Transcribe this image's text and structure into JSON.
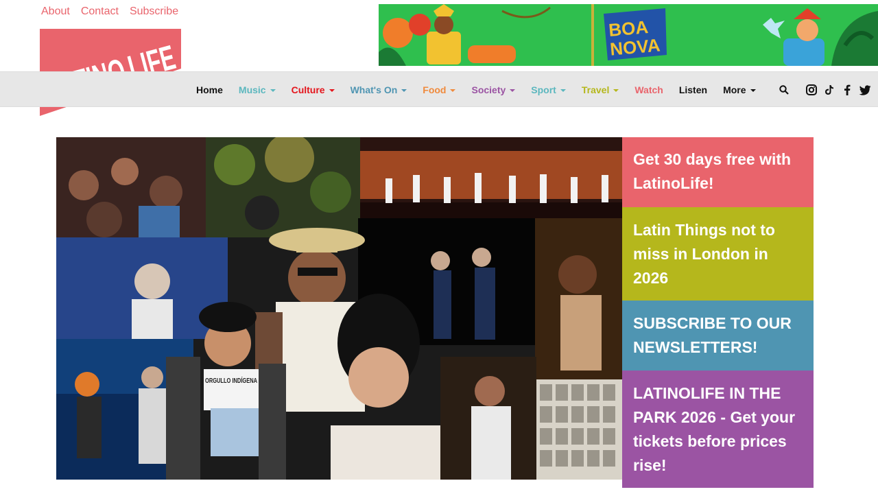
{
  "top_links": [
    "About",
    "Contact",
    "Subscribe"
  ],
  "logo": {
    "text_line1": "LATINO",
    "text_line2": "LIFE",
    "color": "#e9646c"
  },
  "banner": {
    "text_line1": "BOA",
    "text_line2": "NOVA",
    "bg": "#2fbf4e"
  },
  "nav": {
    "items": [
      {
        "label": "Home",
        "color": "#111111",
        "caret": false
      },
      {
        "label": "Music",
        "color": "#5bb7be",
        "caret": true
      },
      {
        "label": "Culture",
        "color": "#e4151c",
        "caret": true
      },
      {
        "label": "What's On",
        "color": "#4f95b2",
        "caret": true
      },
      {
        "label": "Food",
        "color": "#f08a3c",
        "caret": true
      },
      {
        "label": "Society",
        "color": "#9b54a3",
        "caret": true
      },
      {
        "label": "Sport",
        "color": "#5bb7be",
        "caret": true
      },
      {
        "label": "Travel",
        "color": "#b5b71c",
        "caret": true
      },
      {
        "label": "Watch",
        "color": "#e9646c",
        "caret": false
      },
      {
        "label": "Listen",
        "color": "#111111",
        "caret": false
      },
      {
        "label": "More",
        "color": "#111111",
        "caret": true
      }
    ],
    "icons": [
      "search-icon",
      "instagram-icon",
      "tiktok-icon",
      "facebook-icon",
      "twitter-icon"
    ]
  },
  "promos": [
    {
      "text": "Get 30 days free with LatinoLife!",
      "color": "#e9646c"
    },
    {
      "text": "Latin Things not to miss in London in 2026",
      "color": "#b5b71c"
    },
    {
      "text": "SUBSCRIBE TO OUR NEWSLETTERS!",
      "color": "#4f95b2"
    },
    {
      "text": "LATINOLIFE IN THE PARK 2026 - Get your tickets before prices rise!",
      "color": "#9b54a3"
    }
  ],
  "hero": {
    "shirt_text": "ORGULLO INDÍGENA"
  }
}
